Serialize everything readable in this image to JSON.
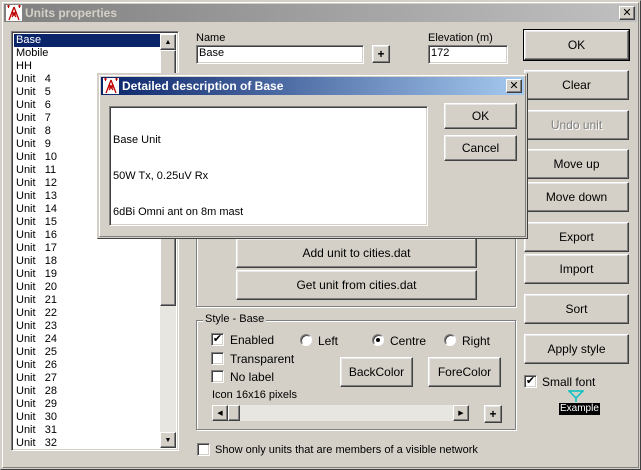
{
  "window": {
    "title": "Units properties",
    "close_glyph": "✕"
  },
  "units_list": {
    "items": [
      "Base",
      "Mobile",
      "HH",
      "Unit   4",
      "Unit   5",
      "Unit   6",
      "Unit   7",
      "Unit   8",
      "Unit   9",
      "Unit   10",
      "Unit   11",
      "Unit   12",
      "Unit   13",
      "Unit   14",
      "Unit   15",
      "Unit   16",
      "Unit   17",
      "Unit   18",
      "Unit   19",
      "Unit   20",
      "Unit   21",
      "Unit   22",
      "Unit   23",
      "Unit   24",
      "Unit   25",
      "Unit   26",
      "Unit   27",
      "Unit   28",
      "Unit   29",
      "Unit   30",
      "Unit   31",
      "Unit   32"
    ],
    "selected": "Base"
  },
  "name_field": {
    "label": "Name",
    "value": "Base",
    "plus_label": "+"
  },
  "elevation_field": {
    "label": "Elevation (m)",
    "value": "172"
  },
  "right_buttons": {
    "ok": "OK",
    "clear": "Clear",
    "undo_unit": "Undo unit",
    "move_up": "Move up",
    "move_down": "Move down",
    "export": "Export",
    "import": "Import",
    "sort": "Sort",
    "apply_style": "Apply style"
  },
  "small_font": {
    "label": "Small font",
    "checked": true,
    "example_label": "Example",
    "icon_color": "#00c0c0"
  },
  "cities_buttons": {
    "add": "Add unit to cities.dat",
    "get": "Get unit from cities.dat"
  },
  "style_group": {
    "title": "Style - Base",
    "enabled_label": "Enabled",
    "enabled_checked": true,
    "transparent_label": "Transparent",
    "transparent_checked": false,
    "no_label_label": "No label",
    "no_label_checked": false,
    "left_label": "Left",
    "centre_label": "Centre",
    "right_label": "Right",
    "alignment_selected": "Centre",
    "back_color_label": "BackColor",
    "fore_color_label": "ForeColor",
    "icon_size_label": "Icon 16x16 pixels",
    "plus_label": "+"
  },
  "show_only_checkbox": {
    "label": "Show only units that are members of a visible network",
    "checked": false
  },
  "dialog": {
    "title": "Detailed description of Base",
    "description_lines": [
      "Base Unit",
      "50W Tx, 0.25uV Rx",
      "6dBi Omni ant on 8m mast"
    ],
    "ok": "OK",
    "cancel": "Cancel",
    "close_glyph": "✕"
  },
  "colors": {
    "active_title": "#0a246a",
    "inactive_title": "#808080",
    "face": "#d4d0c8",
    "selection": "#0a246a"
  }
}
